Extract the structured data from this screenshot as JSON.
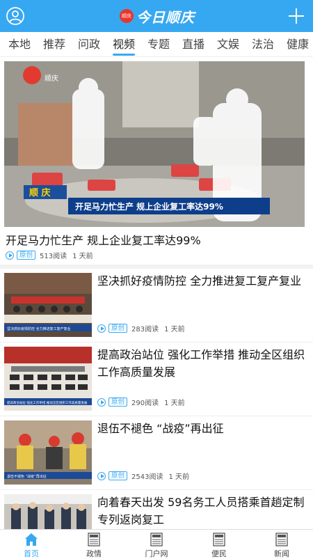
{
  "header": {
    "logo_seal": "顺庆",
    "logo_text": "今日顺庆",
    "user_icon": "user-icon",
    "add_icon": "plus-icon"
  },
  "tabs": [
    "本地",
    "推荐",
    "问政",
    "视频",
    "专题",
    "直播",
    "文娱",
    "法治",
    "健康"
  ],
  "active_tab": "视频",
  "featured": {
    "video_logo_text": "顺庆",
    "caption_place": "顺 庆",
    "caption_text": "开足马力忙生产  规上企业复工率达99%",
    "title": "开足马力忙生产 规上企业复工率达99%",
    "tag": "原创",
    "reads": "513阅读",
    "time": "1 天前"
  },
  "news": [
    {
      "title": "坚决抓好疫情防控 全力推进复工复产复业",
      "thumb_caption": "坚决抓好疫情防控 全力推进复工复产复业",
      "tag": "原创",
      "reads": "283阅读",
      "time": "1 天前"
    },
    {
      "title": "提高政治站位 强化工作举措 推动全区组织工作高质量发展",
      "thumb_caption": "提高政治站位 强化工作举措 推动全区组织工作高质量发展",
      "tag": "原创",
      "reads": "290阅读",
      "time": "1 天前"
    },
    {
      "title": "退伍不褪色 “战疫”再出征",
      "thumb_caption": "退伍不褪色 “战疫”再出征",
      "tag": "原创",
      "reads": "2543阅读",
      "time": "1 天前"
    },
    {
      "title": "向着春天出发 59名务工人员搭乘首趟定制专列返岗复工"
    }
  ],
  "bottom_nav": [
    {
      "label": "首页",
      "icon": "home-icon",
      "active": true
    },
    {
      "label": "政情",
      "icon": "news-icon"
    },
    {
      "label": "门户网",
      "icon": "news-icon"
    },
    {
      "label": "便民",
      "icon": "news-icon"
    },
    {
      "label": "新闻",
      "icon": "news-icon"
    }
  ],
  "colors": {
    "brand": "#36a8f1",
    "seal_red": "#e9352d"
  }
}
